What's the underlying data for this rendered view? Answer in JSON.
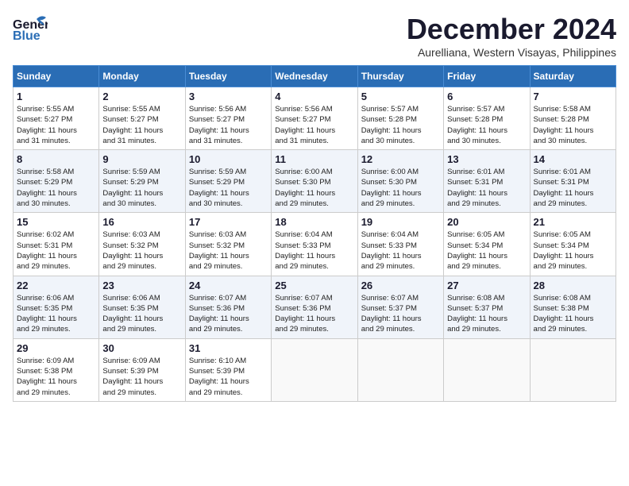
{
  "logo": {
    "line1": "General",
    "line2": "Blue",
    "bird_unicode": "🐦"
  },
  "title": "December 2024",
  "subtitle": "Aurelliana, Western Visayas, Philippines",
  "days_of_week": [
    "Sunday",
    "Monday",
    "Tuesday",
    "Wednesday",
    "Thursday",
    "Friday",
    "Saturday"
  ],
  "weeks": [
    [
      {
        "day": "1",
        "detail": "Sunrise: 5:55 AM\nSunset: 5:27 PM\nDaylight: 11 hours\nand 31 minutes."
      },
      {
        "day": "2",
        "detail": "Sunrise: 5:55 AM\nSunset: 5:27 PM\nDaylight: 11 hours\nand 31 minutes."
      },
      {
        "day": "3",
        "detail": "Sunrise: 5:56 AM\nSunset: 5:27 PM\nDaylight: 11 hours\nand 31 minutes."
      },
      {
        "day": "4",
        "detail": "Sunrise: 5:56 AM\nSunset: 5:27 PM\nDaylight: 11 hours\nand 31 minutes."
      },
      {
        "day": "5",
        "detail": "Sunrise: 5:57 AM\nSunset: 5:28 PM\nDaylight: 11 hours\nand 30 minutes."
      },
      {
        "day": "6",
        "detail": "Sunrise: 5:57 AM\nSunset: 5:28 PM\nDaylight: 11 hours\nand 30 minutes."
      },
      {
        "day": "7",
        "detail": "Sunrise: 5:58 AM\nSunset: 5:28 PM\nDaylight: 11 hours\nand 30 minutes."
      }
    ],
    [
      {
        "day": "8",
        "detail": "Sunrise: 5:58 AM\nSunset: 5:29 PM\nDaylight: 11 hours\nand 30 minutes."
      },
      {
        "day": "9",
        "detail": "Sunrise: 5:59 AM\nSunset: 5:29 PM\nDaylight: 11 hours\nand 30 minutes."
      },
      {
        "day": "10",
        "detail": "Sunrise: 5:59 AM\nSunset: 5:29 PM\nDaylight: 11 hours\nand 30 minutes."
      },
      {
        "day": "11",
        "detail": "Sunrise: 6:00 AM\nSunset: 5:30 PM\nDaylight: 11 hours\nand 29 minutes."
      },
      {
        "day": "12",
        "detail": "Sunrise: 6:00 AM\nSunset: 5:30 PM\nDaylight: 11 hours\nand 29 minutes."
      },
      {
        "day": "13",
        "detail": "Sunrise: 6:01 AM\nSunset: 5:31 PM\nDaylight: 11 hours\nand 29 minutes."
      },
      {
        "day": "14",
        "detail": "Sunrise: 6:01 AM\nSunset: 5:31 PM\nDaylight: 11 hours\nand 29 minutes."
      }
    ],
    [
      {
        "day": "15",
        "detail": "Sunrise: 6:02 AM\nSunset: 5:31 PM\nDaylight: 11 hours\nand 29 minutes."
      },
      {
        "day": "16",
        "detail": "Sunrise: 6:03 AM\nSunset: 5:32 PM\nDaylight: 11 hours\nand 29 minutes."
      },
      {
        "day": "17",
        "detail": "Sunrise: 6:03 AM\nSunset: 5:32 PM\nDaylight: 11 hours\nand 29 minutes."
      },
      {
        "day": "18",
        "detail": "Sunrise: 6:04 AM\nSunset: 5:33 PM\nDaylight: 11 hours\nand 29 minutes."
      },
      {
        "day": "19",
        "detail": "Sunrise: 6:04 AM\nSunset: 5:33 PM\nDaylight: 11 hours\nand 29 minutes."
      },
      {
        "day": "20",
        "detail": "Sunrise: 6:05 AM\nSunset: 5:34 PM\nDaylight: 11 hours\nand 29 minutes."
      },
      {
        "day": "21",
        "detail": "Sunrise: 6:05 AM\nSunset: 5:34 PM\nDaylight: 11 hours\nand 29 minutes."
      }
    ],
    [
      {
        "day": "22",
        "detail": "Sunrise: 6:06 AM\nSunset: 5:35 PM\nDaylight: 11 hours\nand 29 minutes."
      },
      {
        "day": "23",
        "detail": "Sunrise: 6:06 AM\nSunset: 5:35 PM\nDaylight: 11 hours\nand 29 minutes."
      },
      {
        "day": "24",
        "detail": "Sunrise: 6:07 AM\nSunset: 5:36 PM\nDaylight: 11 hours\nand 29 minutes."
      },
      {
        "day": "25",
        "detail": "Sunrise: 6:07 AM\nSunset: 5:36 PM\nDaylight: 11 hours\nand 29 minutes."
      },
      {
        "day": "26",
        "detail": "Sunrise: 6:07 AM\nSunset: 5:37 PM\nDaylight: 11 hours\nand 29 minutes."
      },
      {
        "day": "27",
        "detail": "Sunrise: 6:08 AM\nSunset: 5:37 PM\nDaylight: 11 hours\nand 29 minutes."
      },
      {
        "day": "28",
        "detail": "Sunrise: 6:08 AM\nSunset: 5:38 PM\nDaylight: 11 hours\nand 29 minutes."
      }
    ],
    [
      {
        "day": "29",
        "detail": "Sunrise: 6:09 AM\nSunset: 5:38 PM\nDaylight: 11 hours\nand 29 minutes."
      },
      {
        "day": "30",
        "detail": "Sunrise: 6:09 AM\nSunset: 5:39 PM\nDaylight: 11 hours\nand 29 minutes."
      },
      {
        "day": "31",
        "detail": "Sunrise: 6:10 AM\nSunset: 5:39 PM\nDaylight: 11 hours\nand 29 minutes."
      },
      {
        "day": "",
        "detail": ""
      },
      {
        "day": "",
        "detail": ""
      },
      {
        "day": "",
        "detail": ""
      },
      {
        "day": "",
        "detail": ""
      }
    ]
  ]
}
